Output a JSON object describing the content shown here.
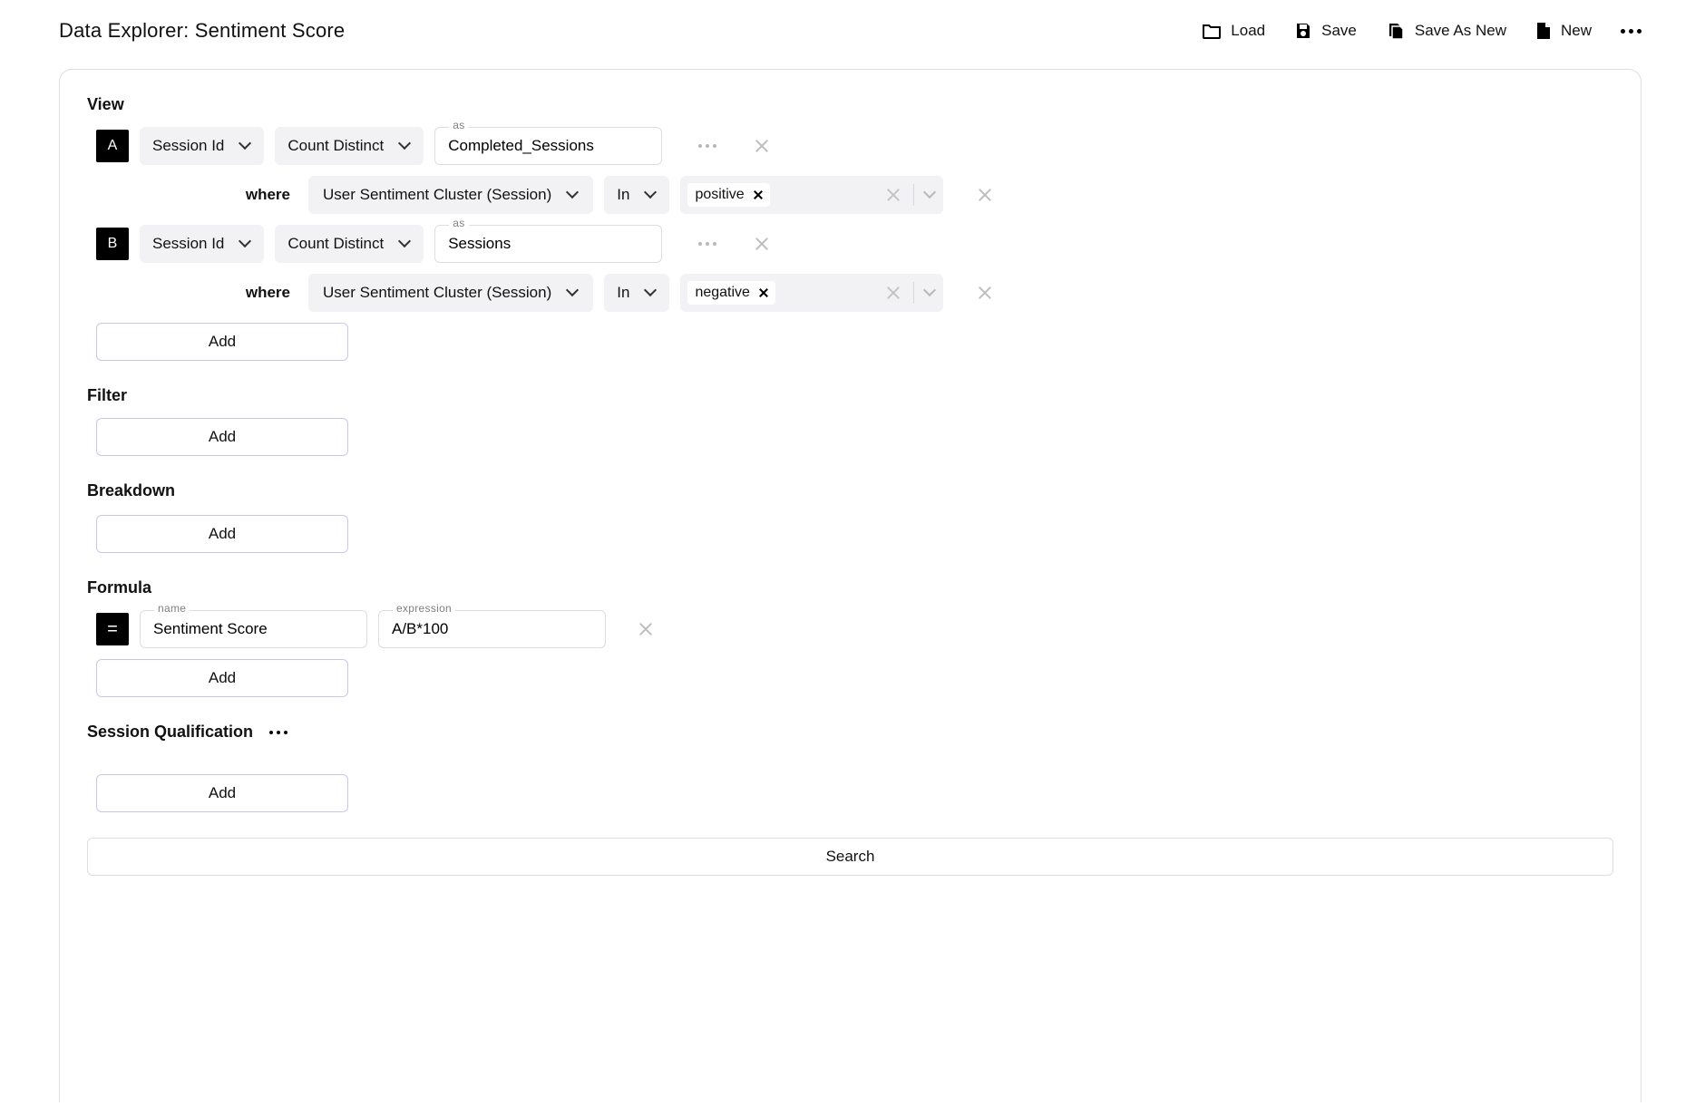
{
  "header": {
    "title": "Data Explorer: Sentiment Score",
    "actions": {
      "load": "Load",
      "save": "Save",
      "save_as_new": "Save As New",
      "new": "New"
    }
  },
  "sections": {
    "view": {
      "title": "View",
      "as_hint": "as",
      "where_label": "where",
      "add_label": "Add",
      "row_a": {
        "badge": "A",
        "field": "Session Id",
        "agg": "Count Distinct",
        "alias": "Completed_Sessions",
        "where_field": "User Sentiment Cluster (Session)",
        "where_op": "In",
        "where_tag": "positive"
      },
      "row_b": {
        "badge": "B",
        "field": "Session Id",
        "agg": "Count Distinct",
        "alias": "Sessions",
        "where_field": "User Sentiment Cluster (Session)",
        "where_op": "In",
        "where_tag": "negative"
      }
    },
    "filter": {
      "title": "Filter",
      "add_label": "Add"
    },
    "breakdown": {
      "title": "Breakdown",
      "add_label": "Add"
    },
    "formula": {
      "title": "Formula",
      "name_hint": "name",
      "expr_hint": "expression",
      "badge": "=",
      "name": "Sentiment Score",
      "expression": "A/B*100",
      "add_label": "Add"
    },
    "session_qualification": {
      "title": "Session Qualification",
      "add_label": "Add"
    }
  },
  "search_label": "Search"
}
